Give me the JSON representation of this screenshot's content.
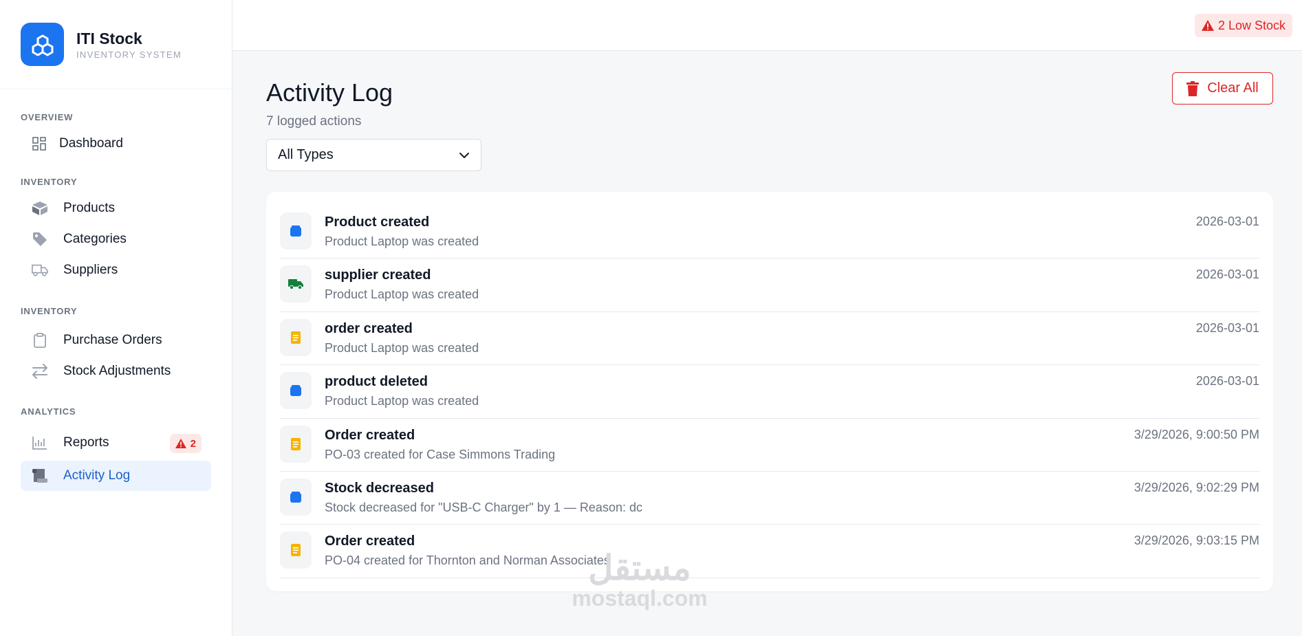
{
  "brand": {
    "title": "ITI Stock",
    "subtitle": "INVENTORY SYSTEM"
  },
  "sidebar": {
    "sections": [
      {
        "label": "OVERVIEW",
        "items": [
          {
            "label": "Dashboard",
            "icon": "grid-icon"
          }
        ]
      },
      {
        "label": "INVENTORY",
        "items": [
          {
            "label": "Products",
            "icon": "box-icon"
          },
          {
            "label": "Categories",
            "icon": "tag-icon"
          },
          {
            "label": "Suppliers",
            "icon": "truck-icon"
          }
        ]
      },
      {
        "label": "INVENTORY",
        "items": [
          {
            "label": "Purchase Orders",
            "icon": "clipboard-icon"
          },
          {
            "label": "Stock Adjustments",
            "icon": "swap-icon"
          }
        ]
      },
      {
        "label": "ANALYTICS",
        "items": [
          {
            "label": "Reports",
            "icon": "chart-icon",
            "badge": "2"
          },
          {
            "label": "Activity Log",
            "icon": "scroll-icon",
            "active": true
          }
        ]
      }
    ]
  },
  "topbar": {
    "low_stock": "2 Low Stock"
  },
  "main": {
    "title": "Activity Log",
    "subtitle": "7 logged actions",
    "clear_label": "Clear All",
    "filter_value": "All Types"
  },
  "log": [
    {
      "title": "Product created",
      "desc": "Product Laptop was created",
      "time": "2026-03-01",
      "kind": "product"
    },
    {
      "title": "supplier created",
      "desc": "Product Laptop was created",
      "time": "2026-03-01",
      "kind": "supplier"
    },
    {
      "title": "order created",
      "desc": "Product Laptop was created",
      "time": "2026-03-01",
      "kind": "order"
    },
    {
      "title": "product deleted",
      "desc": "Product Laptop was created",
      "time": "2026-03-01",
      "kind": "product"
    },
    {
      "title": "Order created",
      "desc": "PO-03 created for Case Simmons Trading",
      "time": "3/29/2026, 9:00:50 PM",
      "kind": "order"
    },
    {
      "title": "Stock decreased",
      "desc": "Stock decreased for \"USB-C Charger\" by 1 — Reason: dc",
      "time": "3/29/2026, 9:02:29 PM",
      "kind": "product"
    },
    {
      "title": "Order created",
      "desc": "PO-04 created for Thornton and Norman Associates",
      "time": "3/29/2026, 9:03:15 PM",
      "kind": "order"
    }
  ],
  "colors": {
    "accent": "#1b74f0",
    "danger": "#dc2626",
    "supplier": "#15803d",
    "order": "#f5b400"
  },
  "watermark": {
    "arabic": "مستقل",
    "latin": "mostaql.com"
  }
}
